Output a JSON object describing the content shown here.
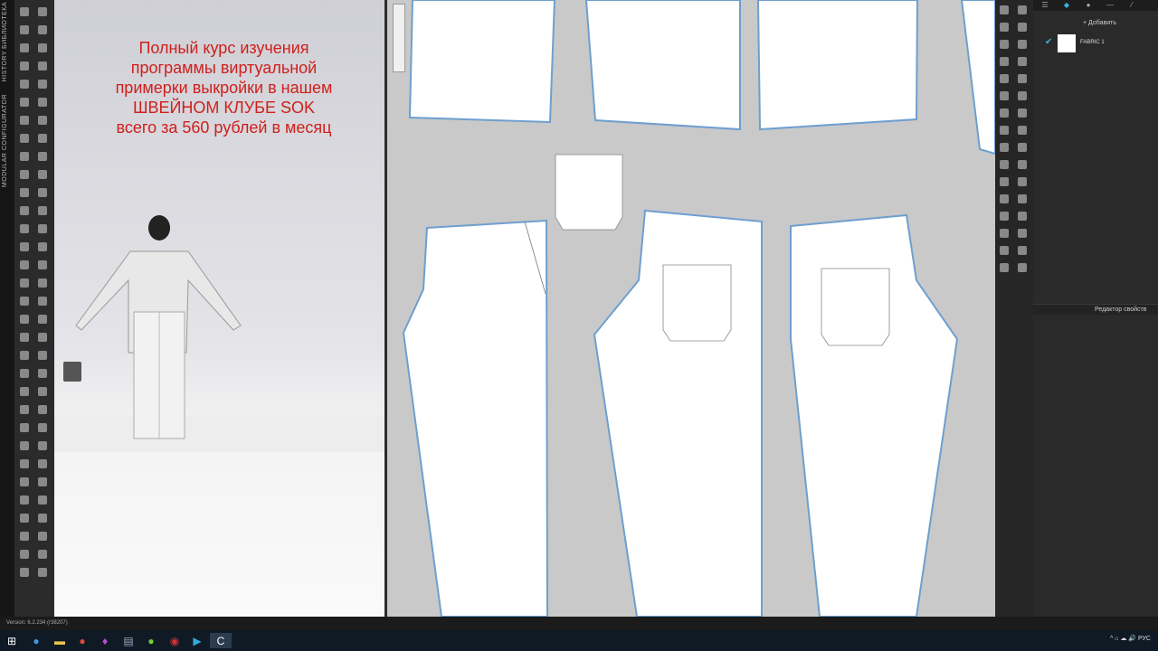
{
  "left_tabs": [
    "БИБЛИОТЕКА",
    "HISTORY",
    "MODULAR CONFIGURATOR"
  ],
  "promo": {
    "lines": [
      "Полный курс изучения",
      "программы виртуальной",
      "примерки выкройки в нашем",
      "ШВЕЙНОМ КЛУБЕ SOK",
      "всего за 560 рублей в месяц"
    ]
  },
  "panel": {
    "add_label": "+ Добавить",
    "fabric_name": "FABRIC 1",
    "property_editor": "Редактор свойств"
  },
  "status": {
    "version": "Version: 6.2.234 (r38207)"
  },
  "taskbar": {
    "apps": [
      "start-icon",
      "edge-icon",
      "explorer-icon",
      "chrome-icon",
      "paint-icon",
      "calculator-icon",
      "utorrent-icon",
      "recorder-icon",
      "media-icon",
      "clo-icon"
    ],
    "language": "РУС"
  },
  "colors": {
    "promo": "#d0201c",
    "accent": "#3bb4e0",
    "seam": "#6e9fcf"
  }
}
